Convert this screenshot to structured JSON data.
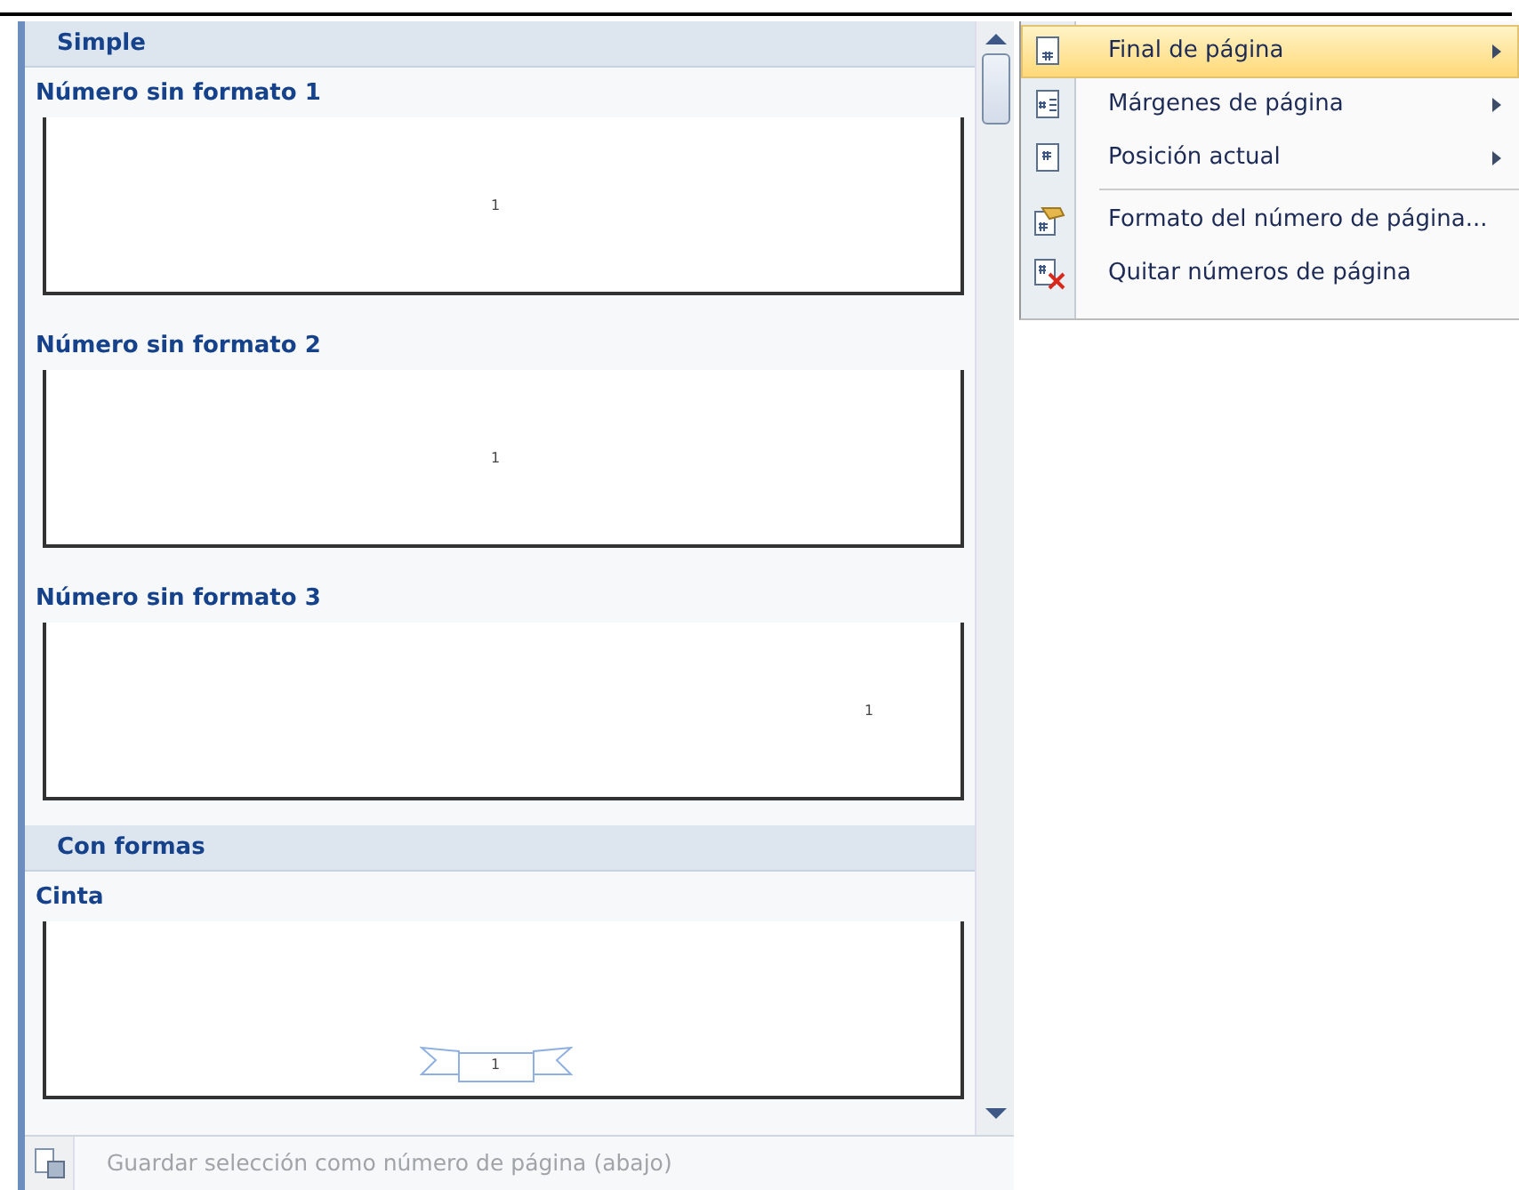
{
  "gallery": {
    "sections": [
      {
        "title": "Simple",
        "items": [
          {
            "title": "Número sin formato 1",
            "kind": "centered",
            "number": "1"
          },
          {
            "title": "Número sin formato 2",
            "kind": "centered",
            "number": "1"
          },
          {
            "title": "Número sin formato 3",
            "kind": "right",
            "number": "1"
          }
        ]
      },
      {
        "title": "Con formas",
        "items": [
          {
            "title": "Cinta",
            "kind": "ribbon",
            "number": "1"
          }
        ]
      }
    ],
    "footer": {
      "label": "Guardar selección como número de página (abajo)",
      "disabled": true
    }
  },
  "menu": {
    "items": [
      {
        "label": "Final de página",
        "kind": "page-bottom",
        "submenu": true,
        "selected": true
      },
      {
        "label": "Márgenes de página",
        "kind": "page-margin",
        "submenu": true,
        "selected": false
      },
      {
        "label": "Posición actual",
        "kind": "page-current",
        "submenu": true,
        "selected": false
      },
      {
        "label": "Formato del número de página...",
        "kind": "format",
        "submenu": false,
        "selected": false
      },
      {
        "label": "Quitar números de página",
        "kind": "remove",
        "submenu": false,
        "selected": false
      }
    ]
  }
}
